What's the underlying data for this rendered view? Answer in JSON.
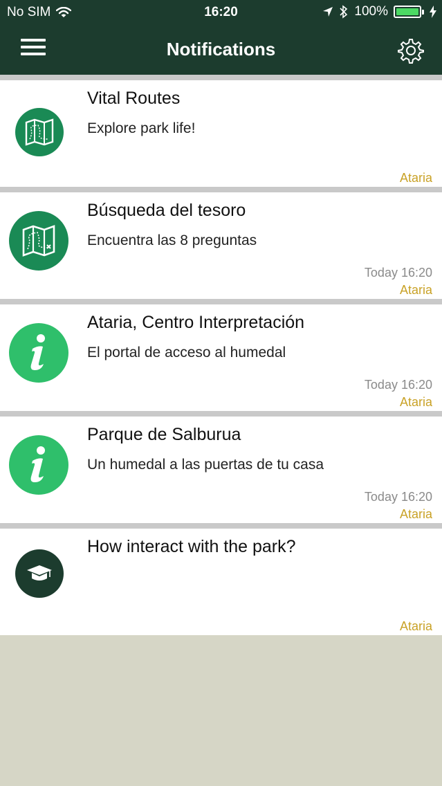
{
  "status_bar": {
    "carrier": "No SIM",
    "time": "16:20",
    "battery": "100%",
    "icons": [
      "wifi-icon",
      "location-arrow-icon",
      "bluetooth-icon",
      "battery-icon",
      "charging-bolt-icon"
    ]
  },
  "nav": {
    "title": "Notifications",
    "menu_icon": "hamburger-menu-icon",
    "settings_icon": "gear-icon"
  },
  "colors": {
    "header_bg": "#1c3c2e",
    "icon_green": "#1a8a55",
    "icon_light_green": "#2fbf6b",
    "icon_dark": "#1c3c2e",
    "source_text": "#c9a227",
    "background": "#d6d6c6"
  },
  "notifications": [
    {
      "title": "Vital Routes",
      "subtitle": "Explore park life!",
      "time": "",
      "source": "Ataria",
      "icon": "map-icon"
    },
    {
      "title": "Búsqueda del tesoro",
      "subtitle": "Encuentra las 8 preguntas",
      "time": "Today 16:20",
      "source": "Ataria",
      "icon": "treasure-map-icon"
    },
    {
      "title": "Ataria, Centro Interpretación",
      "subtitle": "El portal de acceso al humedal",
      "time": "Today 16:20",
      "source": "Ataria",
      "icon": "info-icon"
    },
    {
      "title": "Parque de Salburua",
      "subtitle": "Un humedal a las puertas de tu casa",
      "time": "Today 16:20",
      "source": "Ataria",
      "icon": "info-icon"
    },
    {
      "title": "How interact with the park?",
      "subtitle": "",
      "time": "",
      "source": "Ataria",
      "icon": "graduation-cap-icon"
    }
  ]
}
